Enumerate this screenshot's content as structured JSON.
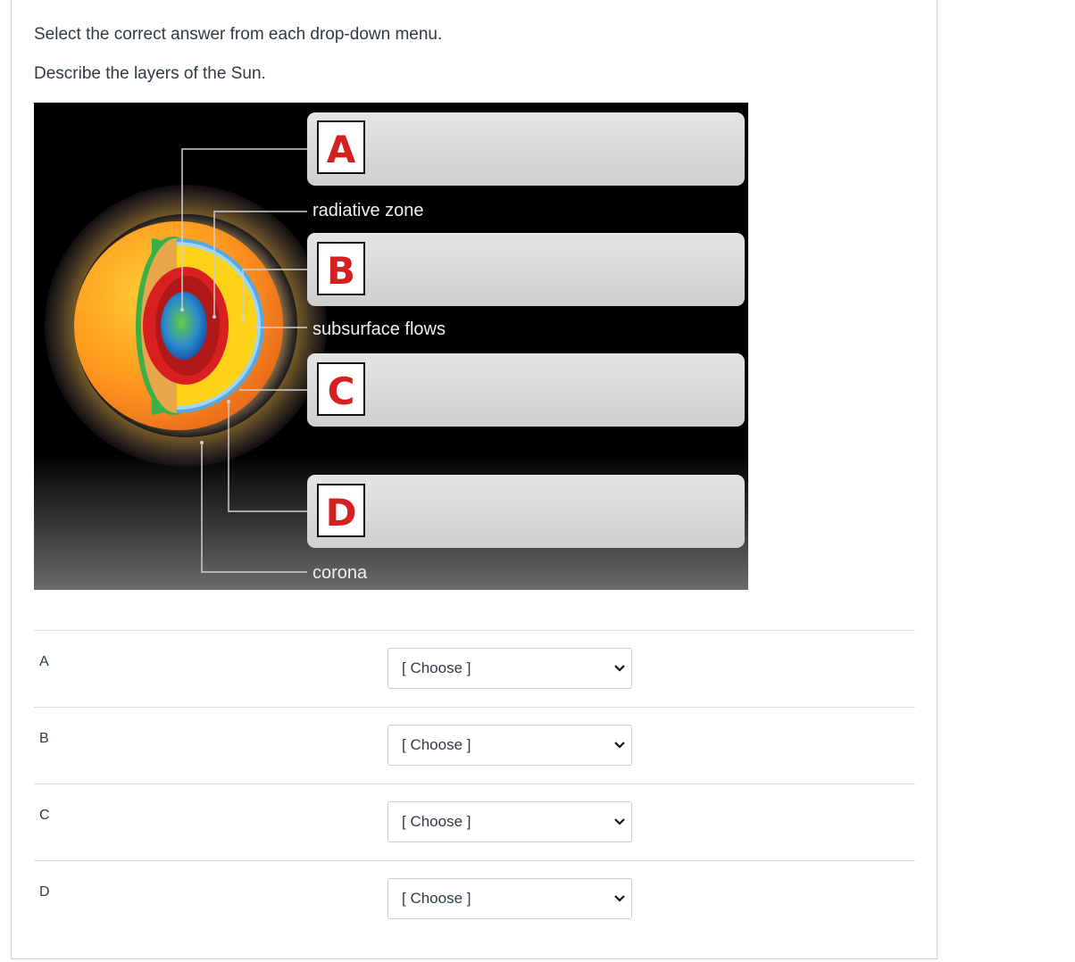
{
  "instructions": "Select the correct answer from each drop-down menu.",
  "question": "Describe the layers of the Sun.",
  "diagram": {
    "box_letters": [
      "A",
      "B",
      "C",
      "D"
    ],
    "labels": {
      "radiative_zone": "radiative zone",
      "subsurface_flows": "subsurface flows",
      "corona": "corona"
    }
  },
  "answers": [
    {
      "label": "A",
      "select": "[ Choose ]"
    },
    {
      "label": "B",
      "select": "[ Choose ]"
    },
    {
      "label": "C",
      "select": "[ Choose ]"
    },
    {
      "label": "D",
      "select": "[ Choose ]"
    }
  ],
  "icons": {
    "dropdown": "chevron-down-icon"
  }
}
